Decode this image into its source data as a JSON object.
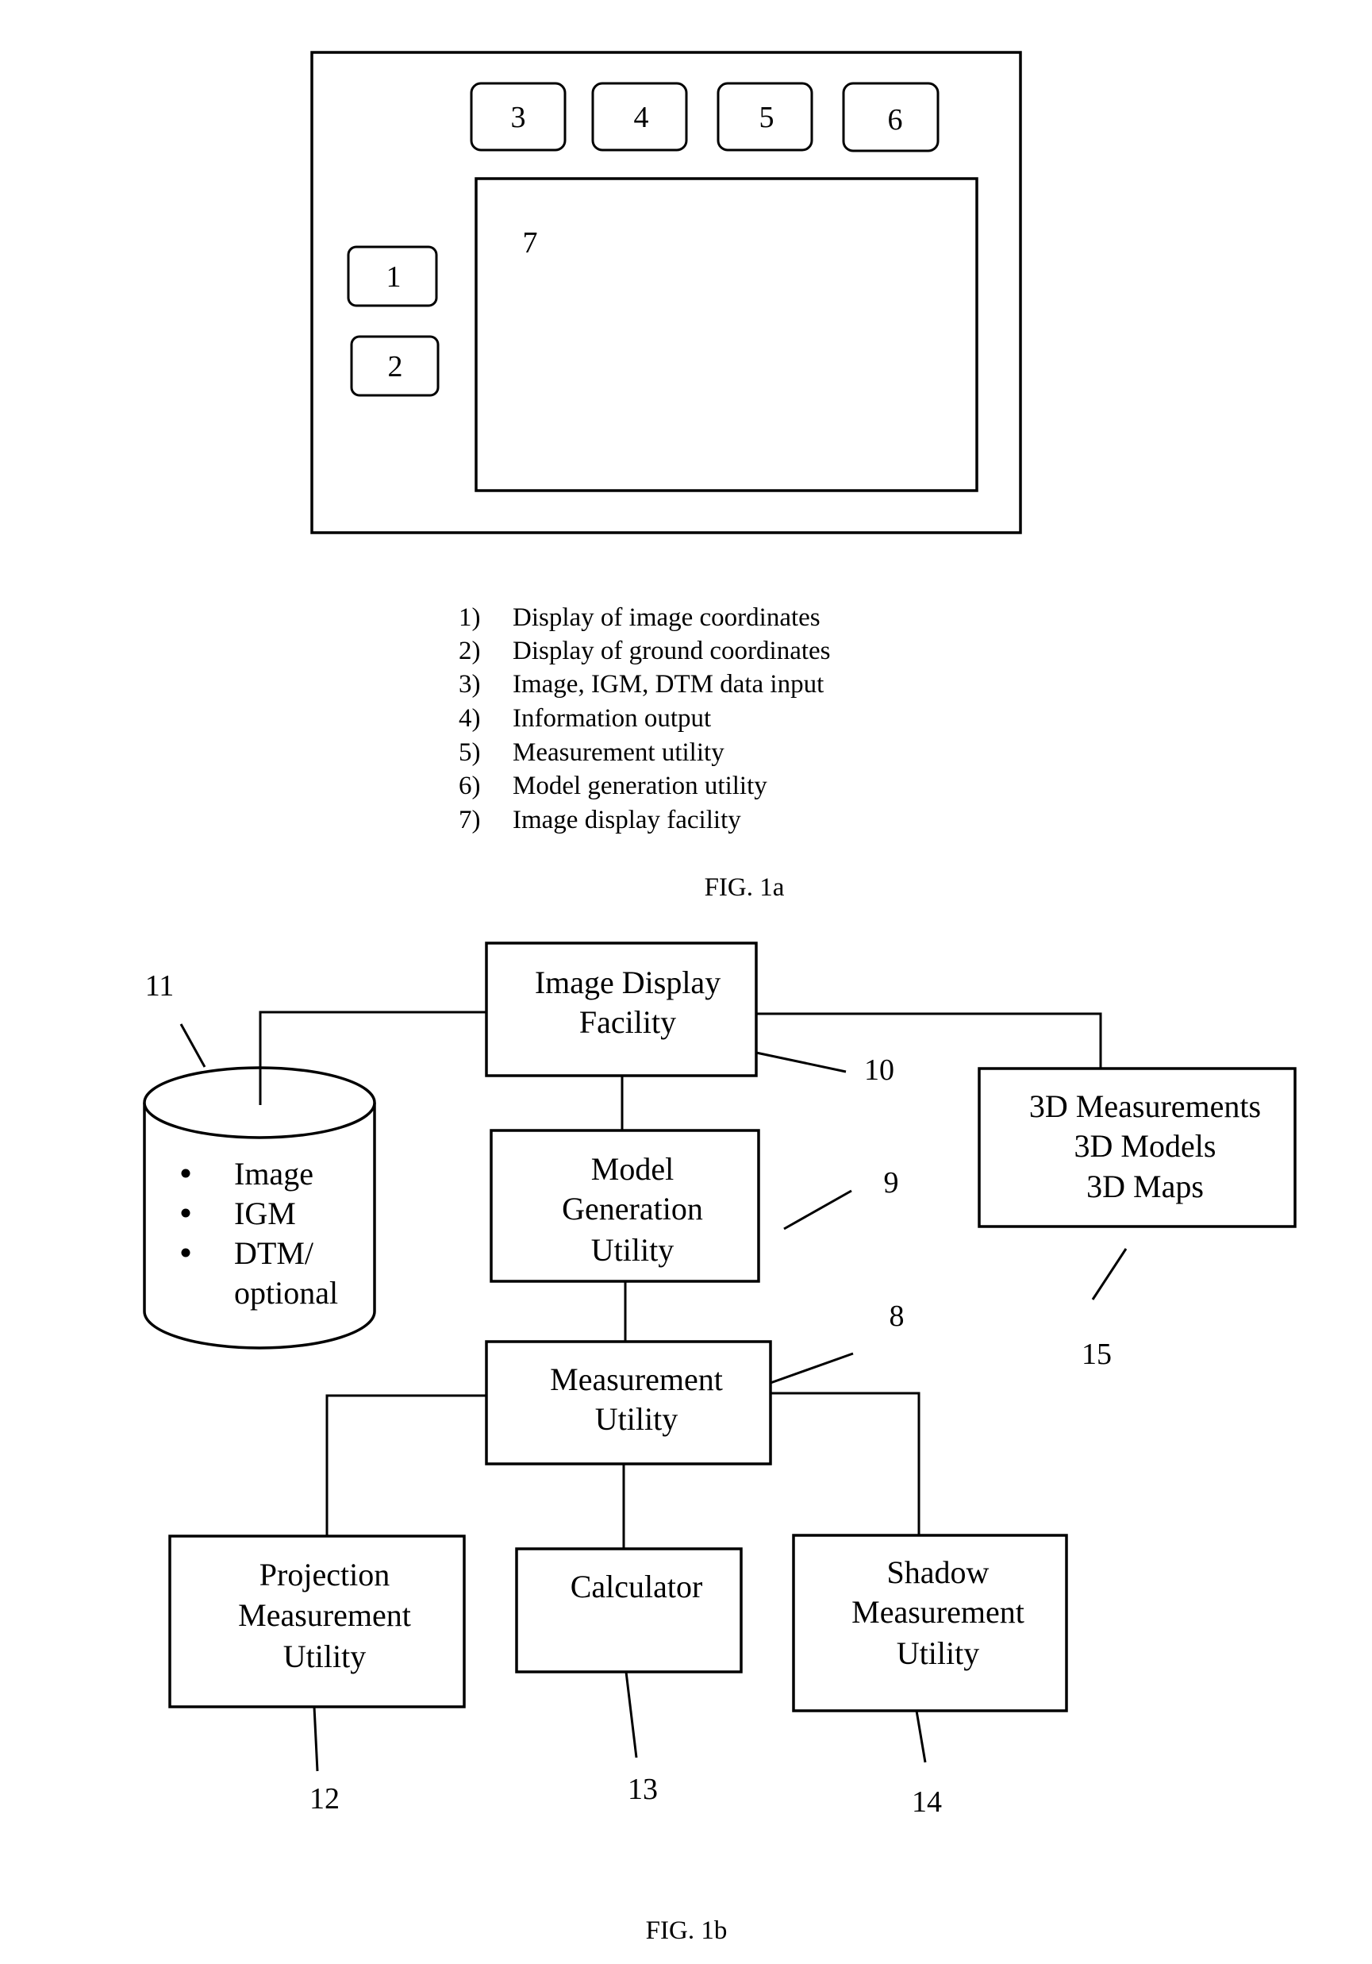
{
  "fig1a": {
    "caption": "FIG. 1a",
    "buttons": {
      "b1": "1",
      "b2": "2",
      "b3": "3",
      "b4": "4",
      "b5": "5",
      "b6": "6"
    },
    "display_label": "7",
    "legend": [
      {
        "num": "1)",
        "text": "Display of image coordinates"
      },
      {
        "num": "2)",
        "text": "Display of ground coordinates"
      },
      {
        "num": "3)",
        "text": "Image, IGM, DTM data input"
      },
      {
        "num": "4)",
        "text": "Information output"
      },
      {
        "num": "5)",
        "text": "Measurement utility"
      },
      {
        "num": "6)",
        "text": "Model generation utility"
      },
      {
        "num": "7)",
        "text": "Image display facility"
      }
    ]
  },
  "fig1b": {
    "caption": "FIG. 1b",
    "image_display": {
      "lines": [
        "Image Display",
        "Facility"
      ],
      "ref": "10"
    },
    "model_generation": {
      "lines": [
        "Model",
        "Generation",
        "Utility"
      ],
      "ref": "9"
    },
    "measurement": {
      "lines": [
        "Measurement",
        "Utility"
      ],
      "ref": "8"
    },
    "outputs_3d": {
      "lines": [
        "3D Measurements",
        "3D Models",
        "3D Maps"
      ],
      "ref": "15"
    },
    "database": {
      "bullets": [
        "Image",
        "IGM",
        "DTM/"
      ],
      "continuation": "optional",
      "ref": "11"
    },
    "projection": {
      "lines": [
        "Projection",
        "Measurement",
        "Utility"
      ],
      "ref": "12"
    },
    "calculator": {
      "lines": [
        "Calculator"
      ],
      "ref": "13"
    },
    "shadow": {
      "lines": [
        "Shadow",
        "Measurement",
        "Utility"
      ],
      "ref": "14"
    }
  }
}
